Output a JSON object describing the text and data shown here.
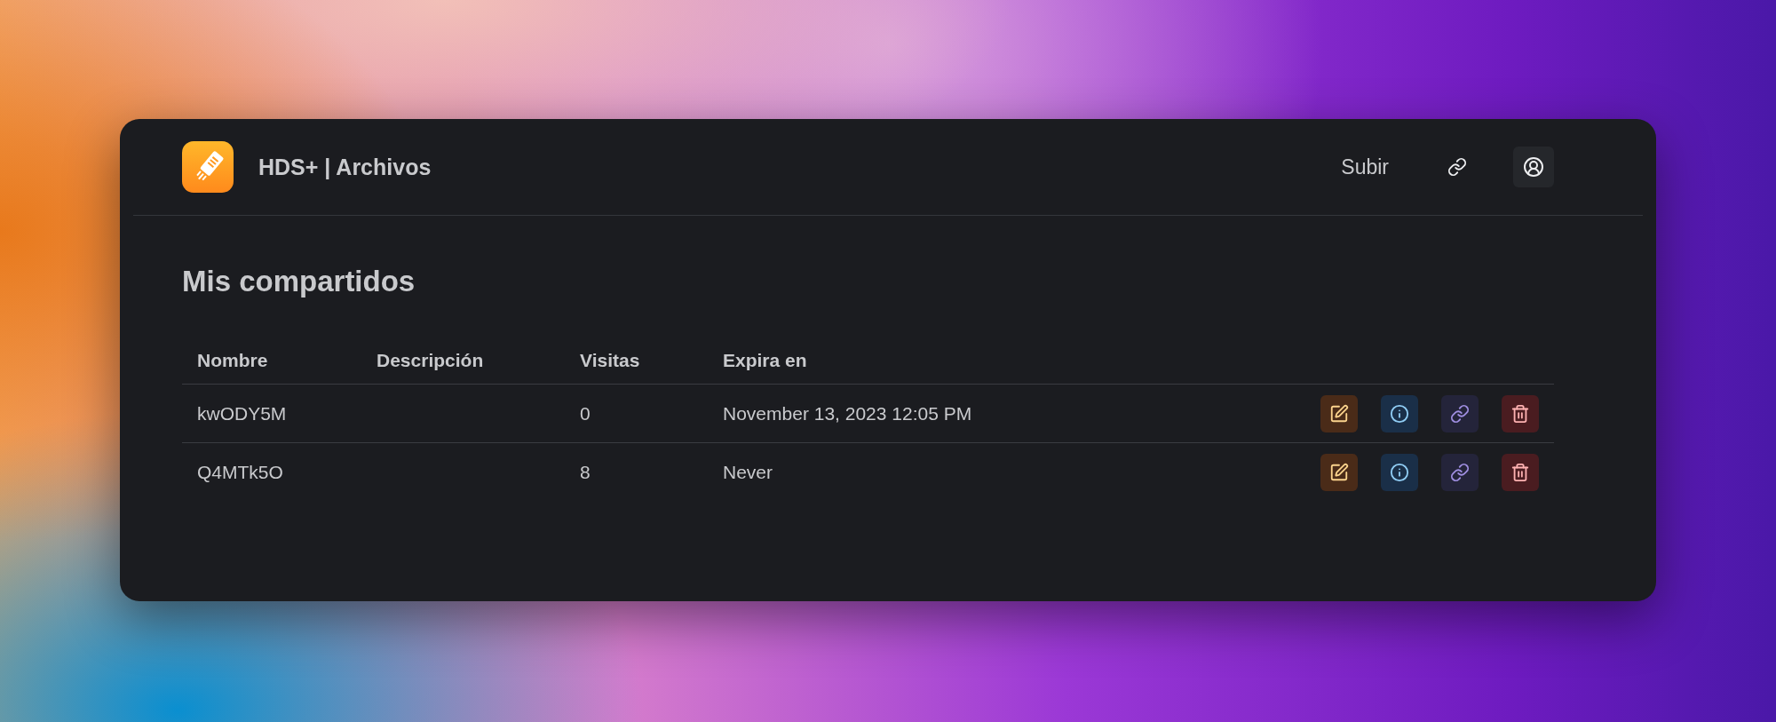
{
  "header": {
    "title": "HDS+ | Archivos",
    "upload_link": "Subir"
  },
  "page_title": "Mis compartidos",
  "table": {
    "columns": [
      "Nombre",
      "Descripción",
      "Visitas",
      "Expira en"
    ],
    "rows": [
      {
        "name": "kwODY5M",
        "description": "",
        "visits": "0",
        "expires": "November 13, 2023 12:05 PM"
      },
      {
        "name": "Q4MTk5O",
        "description": "",
        "visits": "8",
        "expires": "Never"
      }
    ],
    "actions": [
      {
        "kind": "edit"
      },
      {
        "kind": "info"
      },
      {
        "kind": "link"
      },
      {
        "kind": "delete"
      }
    ]
  }
}
